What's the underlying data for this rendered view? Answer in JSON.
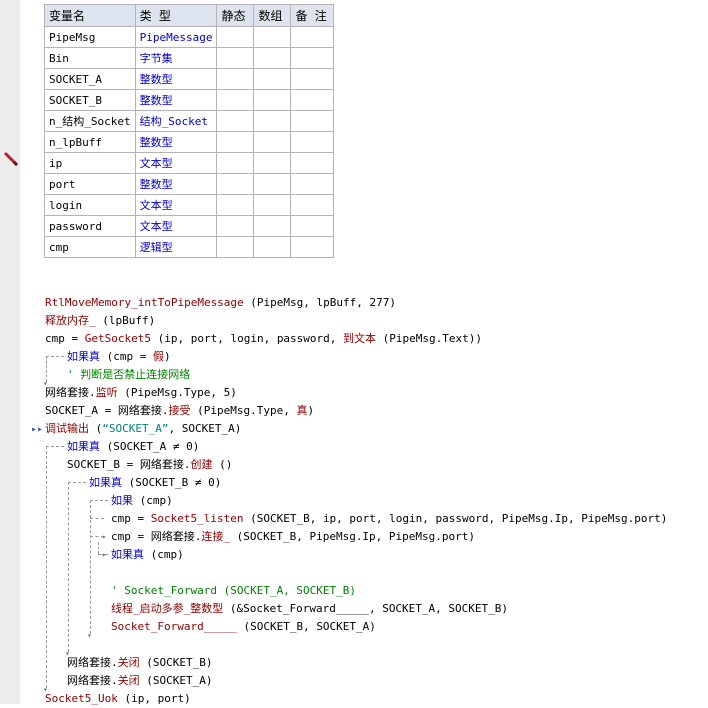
{
  "var_table": {
    "headers": [
      "变量名",
      "类 型",
      "静态",
      "数组",
      "备 注"
    ],
    "rows": [
      {
        "name": "PipeMsg",
        "type": "PipeMessage"
      },
      {
        "name": "Bin",
        "type": "字节集"
      },
      {
        "name": "SOCKET_A",
        "type": "整数型"
      },
      {
        "name": "SOCKET_B",
        "type": "整数型"
      },
      {
        "name": "n_结构_Socket",
        "type": "结构_Socket"
      },
      {
        "name": "n_lpBuff",
        "type": "整数型"
      },
      {
        "name": "ip",
        "type": "文本型"
      },
      {
        "name": "port",
        "type": "整数型"
      },
      {
        "name": "login",
        "type": "文本型"
      },
      {
        "name": "password",
        "type": "文本型"
      },
      {
        "name": "cmp",
        "type": "逻辑型"
      }
    ]
  },
  "code": {
    "l1": {
      "a": "RtlMoveMemory_intToPipeMessage",
      "b": " (PipeMsg, lpBuff, 277)"
    },
    "l2": {
      "a": "释放内存_",
      "b": " (lpBuff)"
    },
    "l3": {
      "a": "cmp = ",
      "b": "GetSocket5",
      "c": " (ip, port, login, password, ",
      "d": "到文本",
      "e": " (PipeMsg.Text))"
    },
    "l4": {
      "a": "如果真",
      "b": " (cmp = ",
      "c": "假",
      "d": ")"
    },
    "l5": {
      "a": "' 判断是否禁止连接网络"
    },
    "l6": {
      "a": "网络套接.",
      "b": "监听",
      "c": " (PipeMsg.Type, 5)"
    },
    "l7": {
      "a": "SOCKET_A = 网络套接.",
      "b": "接受",
      "c": " (PipeMsg.Type, ",
      "d": "真",
      "e": ")"
    },
    "l8": {
      "a": "调试输出",
      "b": " (",
      "c": "“SOCKET_A”",
      "d": ", SOCKET_A)"
    },
    "l9": {
      "a": "如果真",
      "b": " (SOCKET_A ≠ 0)"
    },
    "l10": {
      "a": "SOCKET_B = 网络套接.",
      "b": "创建",
      "c": " ()"
    },
    "l11": {
      "a": "如果真",
      "b": " (SOCKET_B ≠ 0)"
    },
    "l12": {
      "a": "如果",
      "b": " (cmp)"
    },
    "l13": {
      "a": "cmp = ",
      "b": "Socket5_listen",
      "c": " (SOCKET_B, ip, port, login, password, PipeMsg.Ip, PipeMsg.port)"
    },
    "l14": {
      "a": "cmp = 网络套接.",
      "b": "连接_",
      "c": " (SOCKET_B, PipeMsg.Ip, PipeMsg.port)"
    },
    "l15": {
      "a": "如果真",
      "b": " (cmp)"
    },
    "l16": {
      "a": "' Socket_Forward (SOCKET_A, SOCKET_B)"
    },
    "l17": {
      "a": "线程_启动多参_整数型",
      "b": " (&Socket_Forward_____, SOCKET_A, SOCKET_B)"
    },
    "l18": {
      "a": "Socket_Forward_____",
      "b": " (SOCKET_B, SOCKET_A)"
    },
    "l19": {
      "a": "网络套接.",
      "b": "关闭",
      "c": " (SOCKET_B)"
    },
    "l20": {
      "a": "网络套接.",
      "b": "关闭",
      "c": " (SOCKET_A)"
    },
    "l21": {
      "a": "Socket5_Uok",
      "b": " (ip, port)"
    }
  },
  "colors": {
    "function": "#8b0000",
    "keyword": "#0000cc",
    "comment": "#008000",
    "string": "#008080",
    "gutter": "#ececec",
    "table_header": "#dde3ef"
  },
  "icons": [
    "pencil-icon",
    "breakpoint-arrow-icon",
    "fold-arrow-icon"
  ]
}
